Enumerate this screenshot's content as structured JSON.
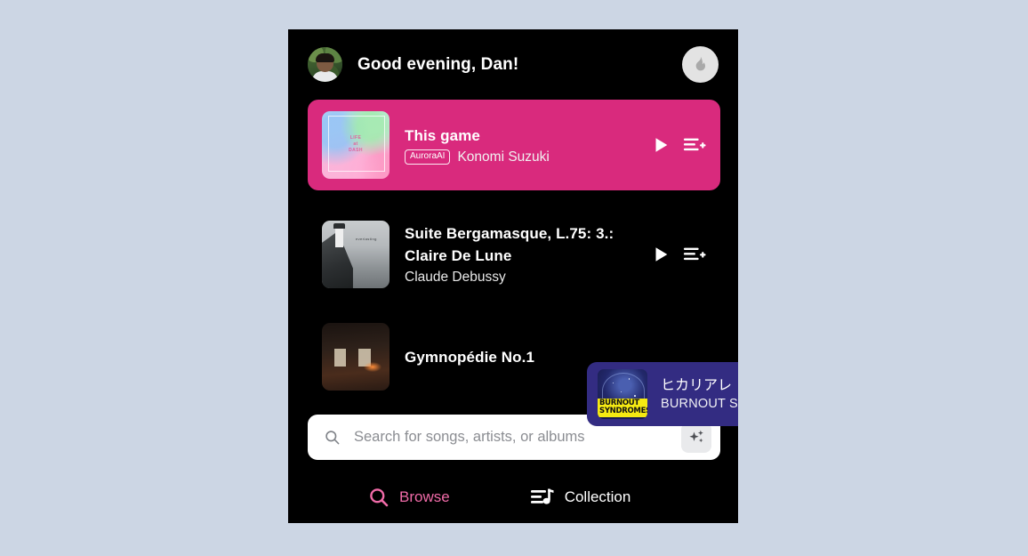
{
  "theme": {
    "page_background": "#ccd6e4",
    "app_background": "#000000",
    "highlight_pink": "#d92a7d",
    "now_playing_blue": "#332c82",
    "accent_pink": "#f06ba8",
    "search_background": "#ffffff"
  },
  "header": {
    "greeting": "Good evening, Dan!",
    "avatar_name": "Dan",
    "flame_icon": "flame-icon"
  },
  "tracks": [
    {
      "title": "This game",
      "badge": "AuroraAI",
      "artist": "Konomi Suzuki",
      "album_art": "life-at-dash-cover",
      "highlighted": true,
      "actions": [
        "play-icon",
        "add-to-queue-icon"
      ]
    },
    {
      "title": "Suite Bergamasque, L.75: 3.: Claire De Lune",
      "title_line1": "Suite Bergamasque, L.75: 3.:",
      "title_line2": "Claire De Lune",
      "badge": "",
      "artist": "Claude Debussy",
      "album_art": "lighthouse-cover",
      "highlighted": false,
      "actions": [
        "play-icon",
        "add-to-queue-icon"
      ]
    },
    {
      "title": "Gymnopédie No.1",
      "badge": "",
      "artist": "",
      "album_art": "dark-room-cover",
      "highlighted": false,
      "actions": []
    }
  ],
  "now_playing": {
    "title": "ヒカリアレ",
    "artist": "BURNOUT SYNDROMES",
    "album_art": "burnout-syndromes-cover",
    "play_icon": "play-icon"
  },
  "search": {
    "placeholder": "Search for songs, artists, or albums",
    "value": "",
    "search_icon": "search-icon",
    "ai_icon": "sparkles-icon"
  },
  "bottom_nav": {
    "items": [
      {
        "label": "Browse",
        "icon": "search-icon",
        "active": true
      },
      {
        "label": "Collection",
        "icon": "playlist-music-icon",
        "active": false
      }
    ]
  }
}
